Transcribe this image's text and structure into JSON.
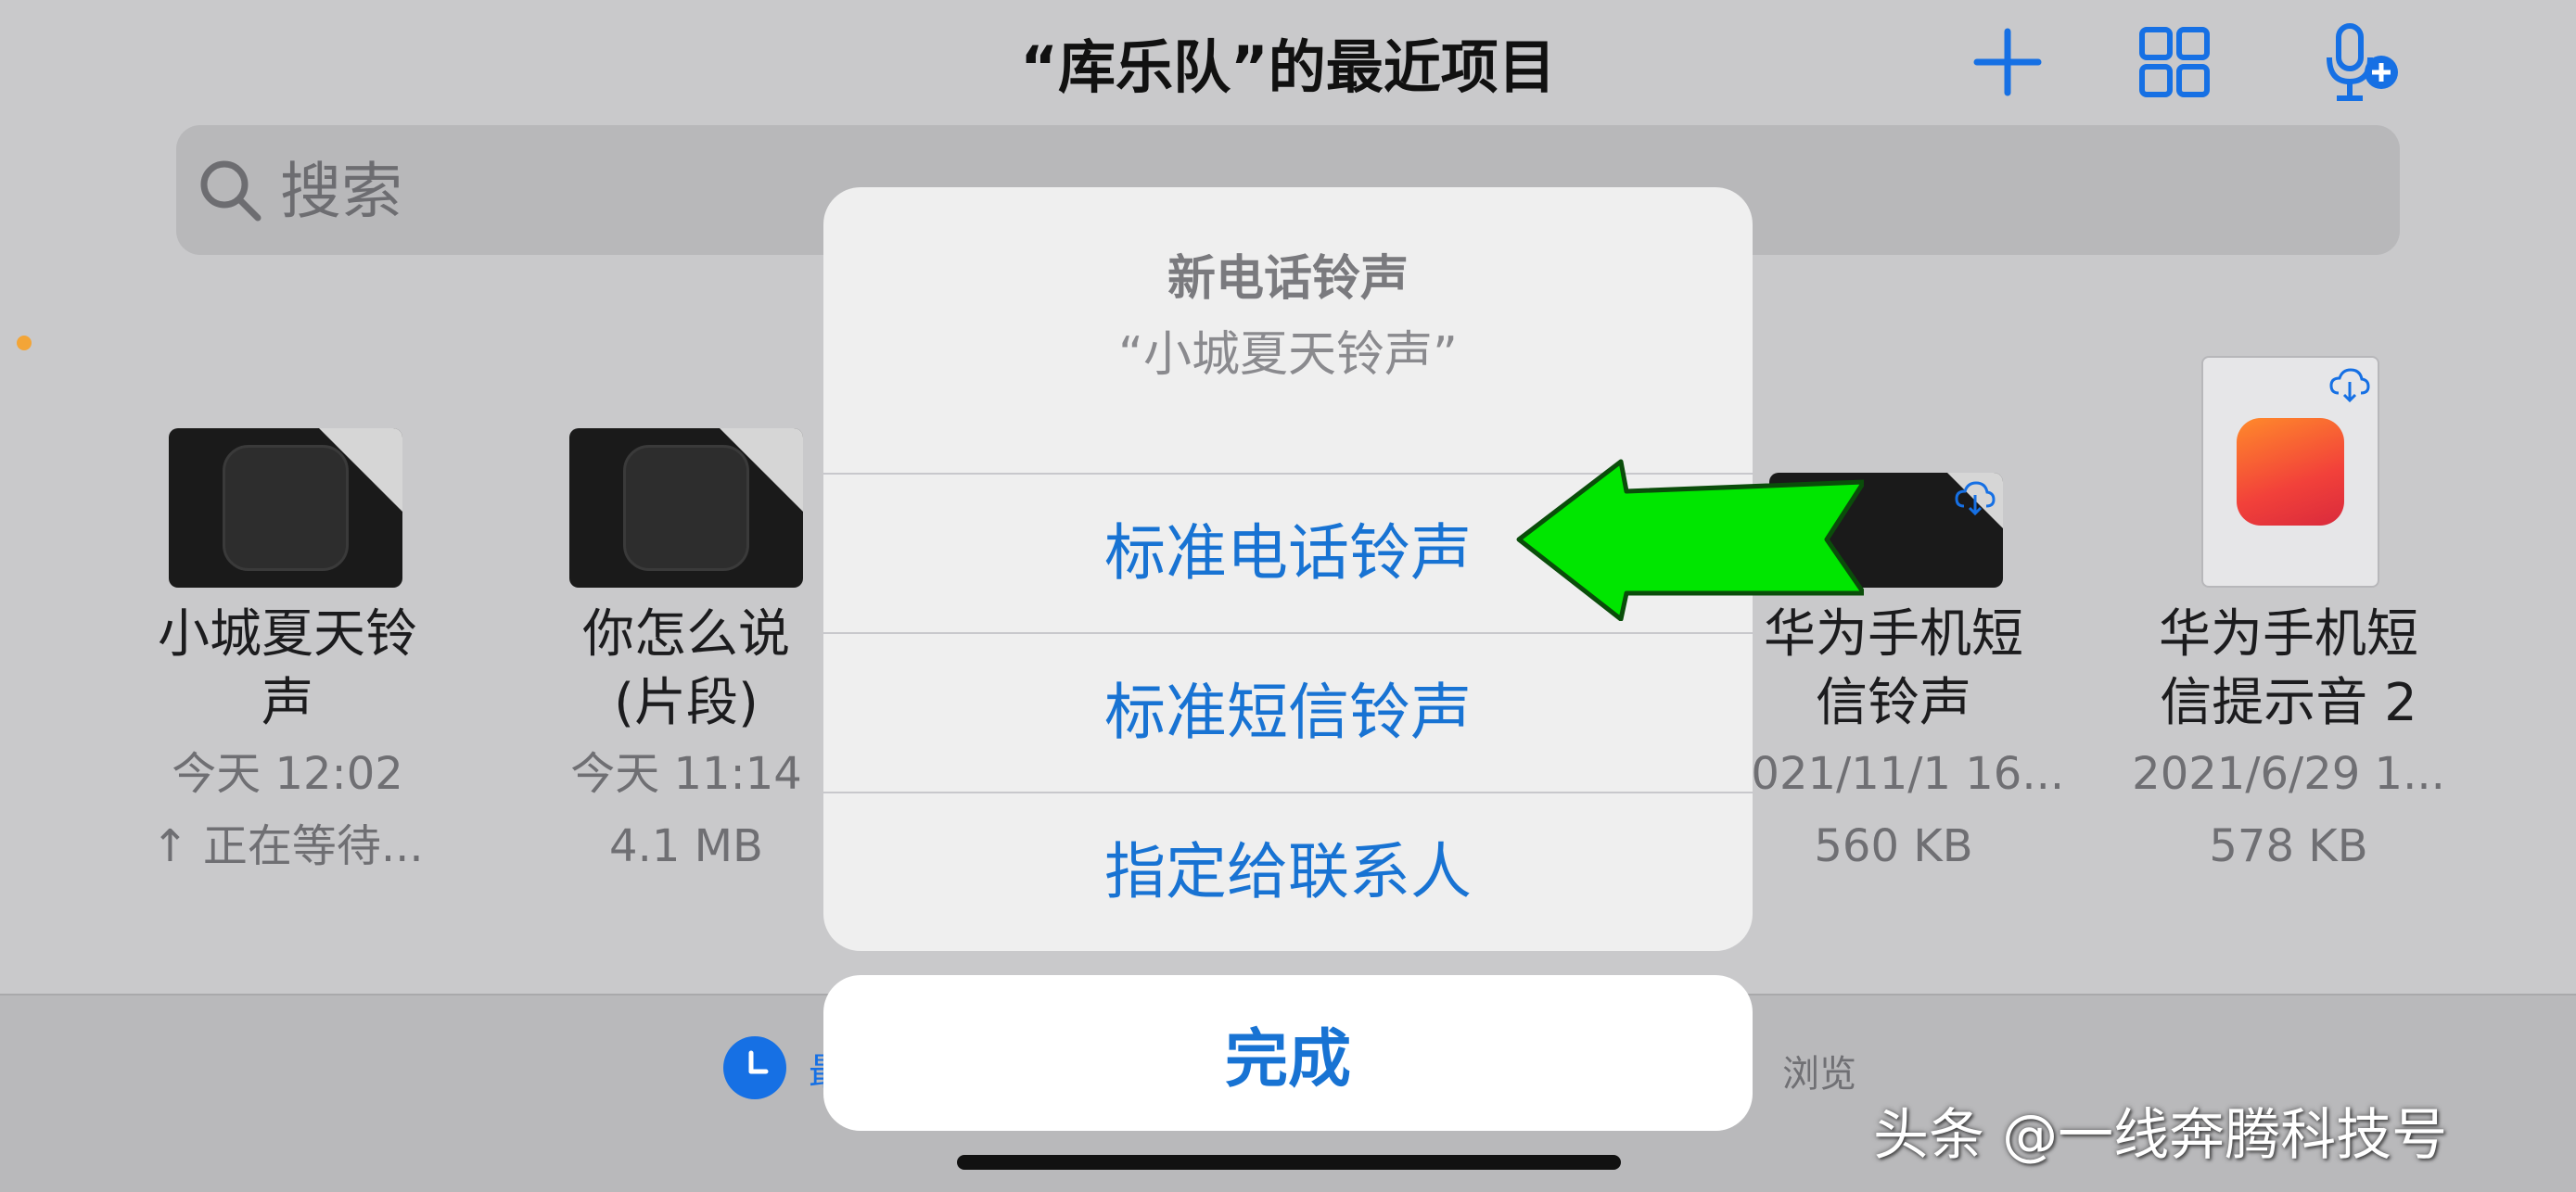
{
  "header": {
    "title": "“库乐队”的最近项目",
    "icons": [
      "plus-icon",
      "grid-icon",
      "microphone-add-icon"
    ]
  },
  "search": {
    "placeholder": "搜索"
  },
  "files": [
    {
      "name_line1": "小城夏天铃",
      "name_line2": "声",
      "date": "今天 12:02",
      "meta": "↑ 正在等待..."
    },
    {
      "name_line1": "你怎么说",
      "name_line2": "(片段)",
      "date": "今天 11:14",
      "meta": "4.1 MB"
    },
    {
      "name_line1": "华为手机短",
      "name_line2": "信铃声",
      "date": "2021/11/1 16...",
      "meta": "560 KB"
    },
    {
      "name_line1": "华为手机短",
      "name_line2": "信提示音 2",
      "date": "2021/6/29 1...",
      "meta": "578 KB"
    }
  ],
  "sheet": {
    "title": "新电话铃声",
    "subtitle": "“小城夏天铃声”",
    "options": [
      "标准电话铃声",
      "标准短信铃声",
      "指定给联系人"
    ],
    "done": "完成"
  },
  "tabbar": {
    "recents": "最",
    "browse": "浏览"
  },
  "watermark": "头条 @一线奔腾科技号",
  "colors": {
    "accent": "#1873d3",
    "arrow": "#00e600",
    "background": "#c9c9cb"
  }
}
